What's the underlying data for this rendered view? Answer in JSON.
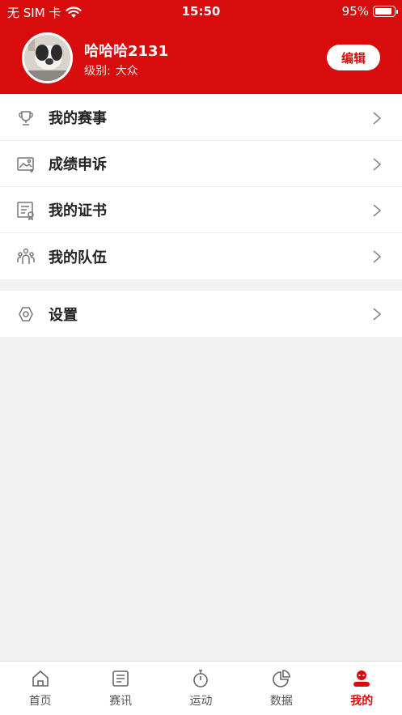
{
  "status_bar": {
    "carrier": "无 SIM 卡",
    "time": "15:50",
    "battery": "95%",
    "battery_level": 0.95
  },
  "profile": {
    "username": "哈哈哈2131",
    "level_label": "级别:",
    "level_value": "大众",
    "edit_label": "编辑"
  },
  "menu_group_1": [
    {
      "label": "我的赛事",
      "icon": "trophy-icon"
    },
    {
      "label": "成绩申诉",
      "icon": "image-appeal-icon"
    },
    {
      "label": "我的证书",
      "icon": "certificate-icon"
    },
    {
      "label": "我的队伍",
      "icon": "team-icon"
    }
  ],
  "menu_group_2": [
    {
      "label": "设置",
      "icon": "hexagon-settings-icon"
    }
  ],
  "tabbar": {
    "active": "我的",
    "active_color": "#d80c0c",
    "tabs": [
      {
        "label": "首页",
        "icon": "home-icon"
      },
      {
        "label": "赛讯",
        "icon": "news-icon"
      },
      {
        "label": "运动",
        "icon": "stopwatch-icon"
      },
      {
        "label": "数据",
        "icon": "pie-chart-icon"
      },
      {
        "label": "我的",
        "icon": "profile-icon"
      }
    ]
  },
  "colors": {
    "brand": "#d80c0c",
    "background": "#f2f2f2"
  }
}
